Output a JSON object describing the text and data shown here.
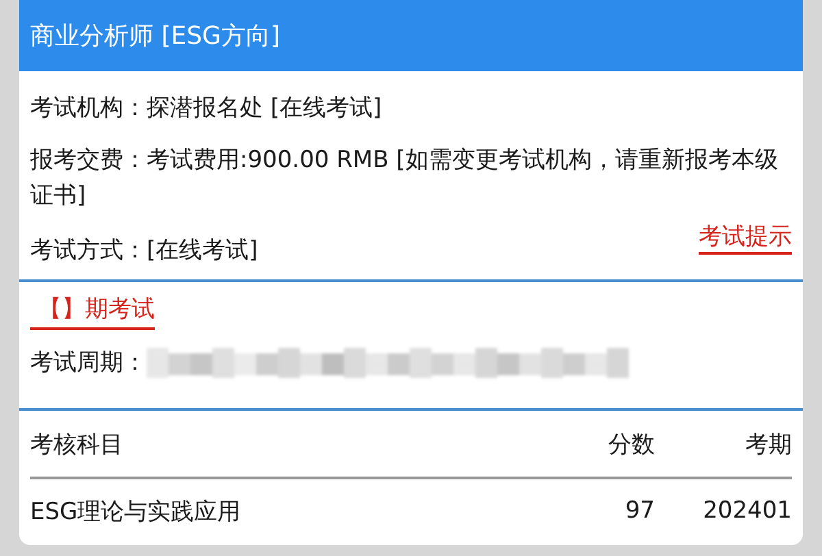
{
  "header": {
    "title": "商业分析师 [ESG方向]"
  },
  "details": [
    {
      "label": "考试机构：",
      "value": "探潜报名处 [在线考试]"
    },
    {
      "label": "报考交费：",
      "value": "考试费用:900.00 RMB [如需变更考试机构，请重新报考本级证书]"
    },
    {
      "label": "考试方式：",
      "value": "[在线考试]"
    }
  ],
  "exam_tip_link": "考试提示",
  "session": {
    "title": "【】期考试",
    "period_label": "考试周期："
  },
  "table": {
    "columns": [
      "考核科目",
      "分数",
      "考期"
    ],
    "rows": [
      [
        "ESG理论与实践应用",
        "97",
        "202401"
      ]
    ]
  }
}
